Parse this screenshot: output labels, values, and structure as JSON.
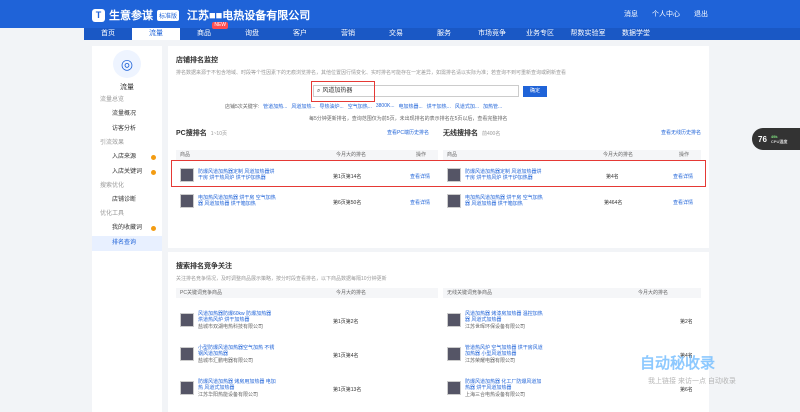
{
  "header": {
    "logo_icon": "T",
    "app_name": "生意参谋",
    "badge": "标准版",
    "company": "江苏■■电热设备有限公司",
    "right_items": [
      "消息",
      "个人中心",
      "退出"
    ]
  },
  "nav": {
    "items": [
      "首页",
      "流量",
      "商品",
      "询盘",
      "客户",
      "营销",
      "交易",
      "服务",
      "市场竞争",
      "业务专区",
      "帮数实验室",
      "数据学堂"
    ],
    "new_label": "NEW"
  },
  "sidebar": {
    "title": "流量",
    "groups": [
      {
        "label": "流量总览",
        "items": [
          "流量概况",
          "访客分析"
        ]
      },
      {
        "label": "引流效果",
        "items": [
          "入店来源",
          "入店关键词"
        ]
      },
      {
        "label": "搜索优化",
        "items": [
          "店铺诊断"
        ]
      },
      {
        "label": "优化工具",
        "items": [
          "我的收藏词",
          "排名查询"
        ]
      }
    ]
  },
  "shop_rank": {
    "title": "店铺排名监控",
    "desc": "排名数据来源于不包含地域、时段等个性因素下的无痕浏览排名，其他位置因行情变化、实时排名可能存在一定差异，如需排名请以实际为准；若查询不到可重新查询或刷新查看",
    "search_value": "风道加热器",
    "search_button": "确定",
    "recommend_label": "店铺5次关键字:",
    "recommend": [
      "管道加热...",
      "风道加热...",
      "导热油炉...",
      "空气加热...",
      "3800K...",
      "电加热器...",
      "烘干加热...",
      "风道式加...",
      "加热管..."
    ],
    "tips": "每5分钟更新排名，查询范围仅为前5页，未出现排名的表示排名在5页以后，查看完整排名",
    "pc_title": "PC搜排名",
    "pc_sub": "1~10页",
    "pc_link": "查看PC端历史排名",
    "wireless_title": "无线搜排名",
    "wireless_sub": "前400名",
    "wireless_link": "查看无线历史排名",
    "headers": [
      "商品",
      "今月大的排名",
      "操作"
    ],
    "rows": [
      {
        "name": "防爆风道加热器定制 风道加热器烘干房 烘干热风炉 烘干炉加热器",
        "pc_rank": "第1页第14名",
        "op": "查看详情",
        "w_name": "防爆风道加热器定制 风道加热器烘干房 烘干热风炉 烘干炉加热器",
        "w_rank": "第4名",
        "w_op": "查看详情"
      },
      {
        "name": "电加热风道加热器 烘干房 空气加热器 风道加热器 烘干箱加热",
        "pc_rank": "第6页第50名",
        "op": "查看详情",
        "w_name": "电加热风道加热器 烘干房 空气加热器 风道加热器 烘干箱加热",
        "w_rank": "第464名",
        "w_op": "查看详情"
      }
    ]
  },
  "competition": {
    "title": "搜索排名竞争关注",
    "desc": "关注排名竞争情况，及时调整商品展示策略，按分时段查看排名，以下商品数据每隔10分钟更新",
    "pc_header": "PC关键词竞争商品",
    "pc_rank_header": "今月大的排名",
    "w_header": "无线关键词竞争商品",
    "w_rank_header": "今月大的排名",
    "rows": [
      {
        "pc_name": "风道加热器防爆60kw 防爆加热器 烘道热风炉 烘干加热器",
        "pc_shop": "盐城市双湖电热科技有限公司",
        "pc_rank": "第1页第2名",
        "w_name": "风道加热器 烤漆房加热器 温控加热器 风道式加热器",
        "w_shop": "江苏世晖环保设备有限公司",
        "w_rank": "第2名"
      },
      {
        "pc_name": "小型防爆风道加热器空气加热 不锈钢风道加热器",
        "pc_shop": "盐城市汇鹏电器有限公司",
        "pc_rank": "第1页第4名",
        "w_name": "管道热风炉 空气加热器 烘干房风道加热器 小型风道加热器",
        "w_shop": "江苏荣耀电器有限公司",
        "w_rank": "第4名"
      },
      {
        "pc_name": "防爆风道加热器 烤房用加热器 电加热 风道式加热器",
        "pc_shop": "江苏华阳热能设备有限公司",
        "pc_rank": "第1页第13名",
        "w_name": "防爆风道加热器 化工厂防爆风道加热器 烘干风道加热器",
        "w_shop": "上海三合电热设备有限公司",
        "w_rank": "第6名"
      }
    ]
  },
  "chat": {
    "count": "76",
    "speed": "49k",
    "label": "CPU温度"
  },
  "watermark": {
    "main": "自动秘收录",
    "sub": "我上链接 来访一点 自动收录"
  }
}
